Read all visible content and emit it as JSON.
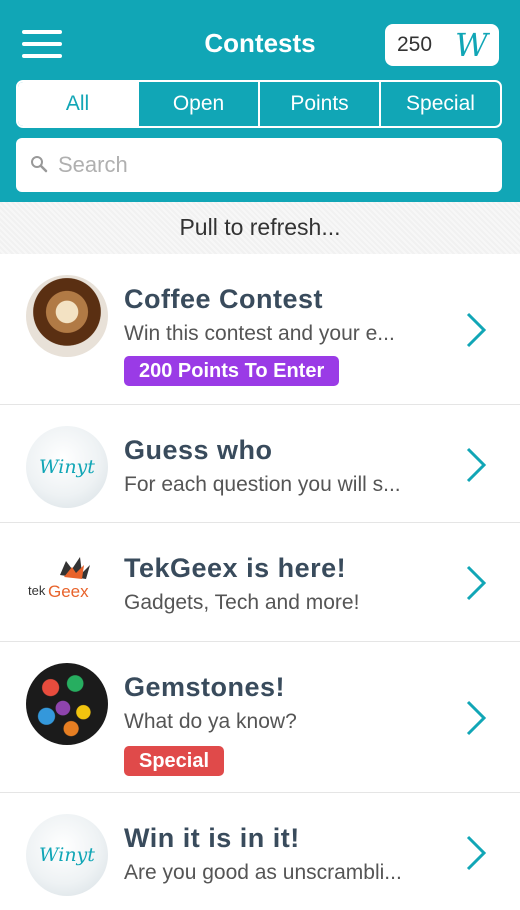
{
  "header": {
    "title": "Contests",
    "points": "250",
    "points_logo": "W"
  },
  "tabs": [
    {
      "label": "All",
      "active": true
    },
    {
      "label": "Open",
      "active": false
    },
    {
      "label": "Points",
      "active": false
    },
    {
      "label": "Special",
      "active": false
    }
  ],
  "search": {
    "placeholder": "Search",
    "value": ""
  },
  "refresh": {
    "text": "Pull to refresh..."
  },
  "contests": [
    {
      "title": "Coffee Contest",
      "subtitle": "Win this contest and your e...",
      "badge": "200 Points To Enter",
      "badge_color": "#9a3be6",
      "avatar": "coffee-cup-image"
    },
    {
      "title": "Guess who",
      "subtitle": "For each question you will s...",
      "badge": "",
      "avatar": "winyt-logo",
      "avatar_text": "Winyt"
    },
    {
      "title": "TekGeex is here!",
      "subtitle": "Gadgets, Tech and more!",
      "badge": "",
      "avatar": "tekgeex-logo",
      "avatar_text": "tekGeex"
    },
    {
      "title": "Gemstones!",
      "subtitle": "What do ya know?",
      "badge": "Special",
      "badge_color": "#e04a4a",
      "avatar": "gemstones-image"
    },
    {
      "title": "Win it is in it!",
      "subtitle": "Are you good as unscrambli...",
      "badge": "",
      "avatar": "winyt-logo",
      "avatar_text": "Winyt"
    }
  ],
  "colors": {
    "accent": "#11a6b6",
    "title_text": "#394b5c"
  }
}
